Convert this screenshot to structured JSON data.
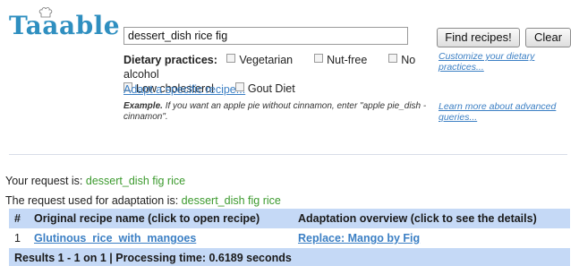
{
  "logo": {
    "text": "Taaable",
    "icon": "chef-hat-icon"
  },
  "search": {
    "value": "dessert_dish rice fig"
  },
  "buttons": {
    "find": "Find recipes!",
    "clear": "Clear"
  },
  "dietary": {
    "label": "Dietary practices:",
    "options": [
      "Vegetarian",
      "Nut-free",
      "No alcohol",
      "Low cholesterol",
      "Gout Diet"
    ]
  },
  "links": {
    "customize": "Customize your dietary practices...",
    "adapt": "Adapt a specific recipe...",
    "learn_more": "Learn more about advanced queries..."
  },
  "example": {
    "label": "Example.",
    "text": "If you want an apple pie without cinnamon, enter \"apple pie_dish -cinnamon\"."
  },
  "request": {
    "your_label": "Your request is:",
    "your_value": "dessert_dish fig rice",
    "adaptation_label": "The request used for adaptation is:",
    "adaptation_value": "dessert_dish fig rice"
  },
  "table": {
    "headers": [
      "#",
      "Original recipe name (click to open recipe)",
      "Adaptation overview (click to see the details)"
    ],
    "rows": [
      {
        "num": "1",
        "name": "Glutinous_rice_with_mangoes",
        "overview": "Replace: Mango by Fig"
      }
    ],
    "footer": "Results 1 - 1 on 1 | Processing time: 0.6189 seconds"
  }
}
